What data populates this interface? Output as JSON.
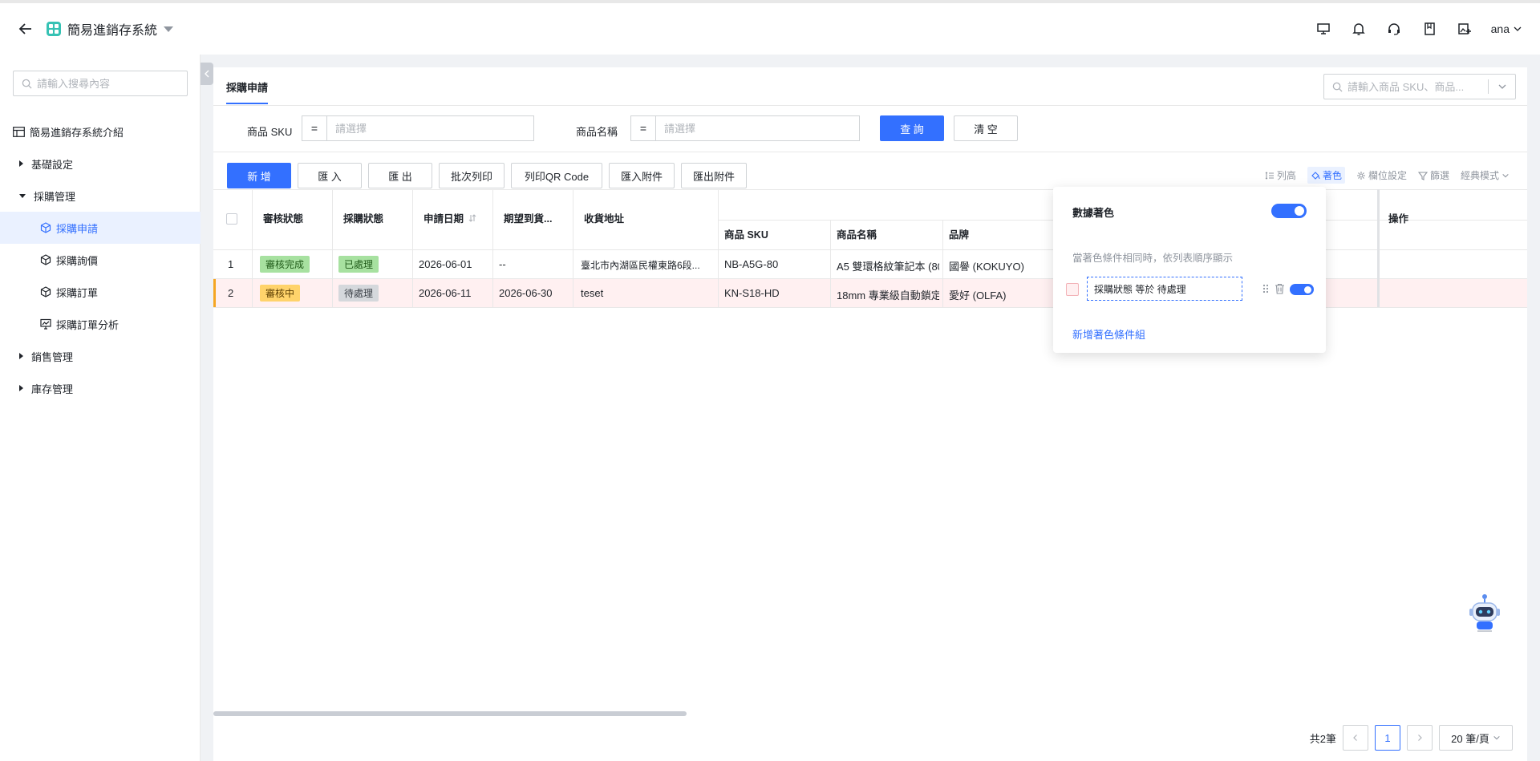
{
  "app": {
    "title": "簡易進銷存系統",
    "user": "ana"
  },
  "sidebar": {
    "search_placeholder": "請輸入搜尋內容",
    "intro": "簡易進銷存系統介紹",
    "groups": [
      {
        "label": "基礎設定",
        "expanded": false
      },
      {
        "label": "採購管理",
        "expanded": true
      },
      {
        "label": "銷售管理",
        "expanded": false
      },
      {
        "label": "庫存管理",
        "expanded": false
      }
    ],
    "purchase_items": [
      {
        "label": "採購申請",
        "active": true
      },
      {
        "label": "採購詢價",
        "active": false
      },
      {
        "label": "採購訂單",
        "active": false
      },
      {
        "label": "採購訂單分析",
        "active": false
      }
    ]
  },
  "main": {
    "tab": "採購申請",
    "search_placeholder": "請輸入商品 SKU、商品..."
  },
  "filters": {
    "sku_label": "商品 SKU",
    "sku_op": "=",
    "sku_placeholder": "請選擇",
    "name_label": "商品名稱",
    "name_op": "=",
    "name_placeholder": "請選擇",
    "query_btn": "查 詢",
    "clear_btn": "清 空"
  },
  "toolbar": {
    "add": "新 增",
    "import": "匯 入",
    "export": "匯 出",
    "batch_print": "批次列印",
    "print_qr": "列印QR Code",
    "import_attach": "匯入附件",
    "export_attach": "匯出附件",
    "row_height": "列高",
    "color": "著色",
    "column_settings": "欄位設定",
    "filter": "篩選",
    "mode": "經典模式"
  },
  "table": {
    "headers": {
      "review_status": "審核狀態",
      "purchase_status": "採購狀態",
      "apply_date": "申請日期",
      "expected_date": "期望到貨...",
      "address": "收貨地址",
      "sku": "商品 SKU",
      "product_name": "商品名稱",
      "brand": "品牌",
      "actions": "操作"
    },
    "rows": [
      {
        "no": "1",
        "review_status": "審核完成",
        "purchase_status": "已處理",
        "apply_date": "2026-06-01",
        "expected_date": "--",
        "address": "臺北市內湖區民權東路6段...",
        "sku": "NB-A5G-80",
        "product_name": "A5 雙環格紋筆記本 (80",
        "brand": "國譽 (KOKUYO)"
      },
      {
        "no": "2",
        "review_status": "審核中",
        "purchase_status": "待處理",
        "apply_date": "2026-06-11",
        "expected_date": "2026-06-30",
        "address": "teset",
        "sku": "KN-S18-HD",
        "product_name": "18mm 專業級自動鎖定",
        "brand": "愛好 (OLFA)"
      }
    ]
  },
  "pagination": {
    "total": "共2筆",
    "current_page": "1",
    "page_size": "20 筆/頁"
  },
  "color_popover": {
    "title": "數據著色",
    "hint": "當著色條件相同時，依列表順序顯示",
    "condition": "採購狀態 等於 待處理",
    "add_group": "新增著色條件組",
    "enabled": true
  },
  "colors": {
    "primary": "#3370ff",
    "row_highlight": "#fff0f1",
    "row_indicator": "#f5a623",
    "tag_green": "#a7e1a0",
    "tag_yellow": "#ffd36b",
    "tag_gray": "#d5d8dc"
  }
}
